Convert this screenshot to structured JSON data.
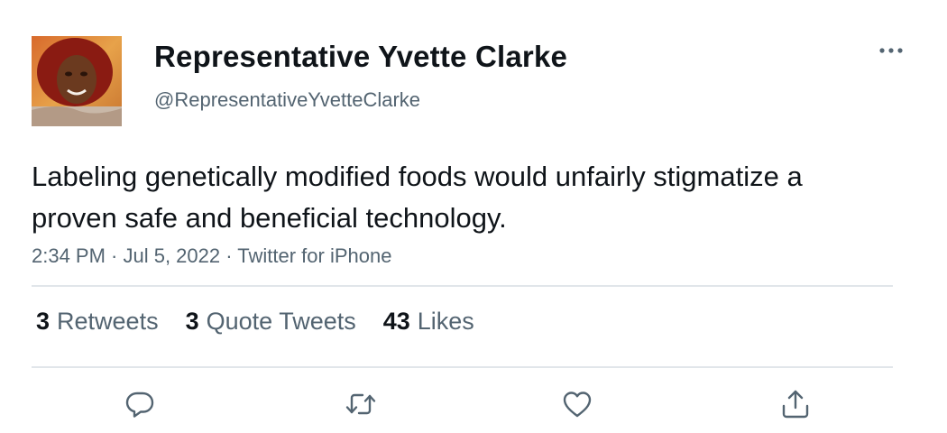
{
  "tweet": {
    "author_name": "Representative Yvette Clarke",
    "author_handle": "@RepresentativeYvetteClarke",
    "text": "Labeling genetically modified foods would unfairly stigmatize a proven safe and beneficial technology.",
    "meta": "2:34 PM · Jul 5, 2022 · Twitter for iPhone"
  },
  "stats": {
    "retweets_count": "3",
    "retweets_label": "Retweets",
    "quotes_count": "3",
    "quotes_label": "Quote Tweets",
    "likes_count": "43",
    "likes_label": "Likes"
  },
  "icons": {
    "more": "more-dots-icon",
    "reply": "reply-icon",
    "retweet": "retweet-icon",
    "like": "heart-icon",
    "share": "share-icon"
  },
  "colors": {
    "text_primary": "#0f1419",
    "text_secondary": "#536471",
    "divider": "#e1e6ea"
  }
}
